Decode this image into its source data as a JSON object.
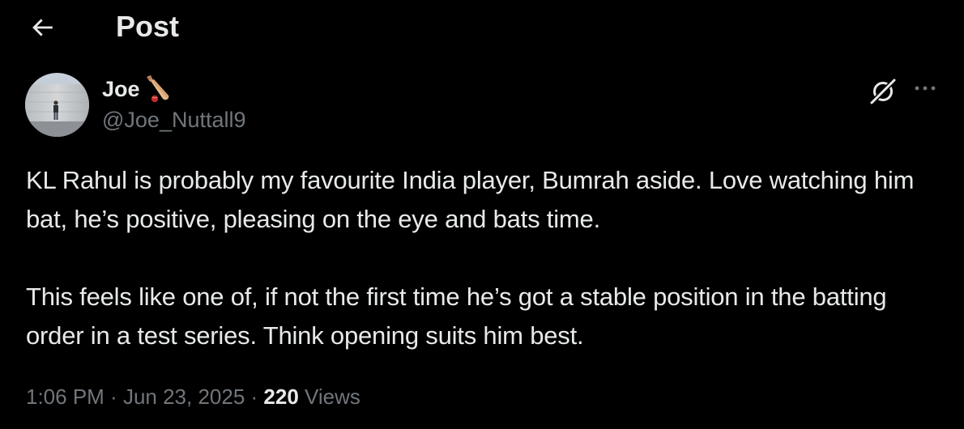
{
  "header": {
    "back_icon": "arrow-left-icon",
    "title": "Post"
  },
  "author": {
    "display_name": "Joe",
    "name_emoji_icon": "cricket-bat-icon",
    "handle": "@Joe_Nuttall9"
  },
  "actions": {
    "grok_icon": "grok-icon",
    "more_icon": "more-horizontal-icon"
  },
  "tweet": {
    "paragraph_1": "KL Rahul is probably my favourite India player, Bumrah aside. Love watching him bat, he’s positive, pleasing on the eye and bats time.",
    "paragraph_2": "This feels like one of, if not the first time he’s got a stable position in the batting order in a test series. Think opening suits him best."
  },
  "meta": {
    "time": "1:06 PM",
    "separator": " · ",
    "date": "Jun 23, 2025",
    "views_count": "220",
    "views_label": " Views"
  },
  "colors": {
    "background": "#000000",
    "text_primary": "#e7e9ea",
    "text_secondary": "#71767b"
  }
}
